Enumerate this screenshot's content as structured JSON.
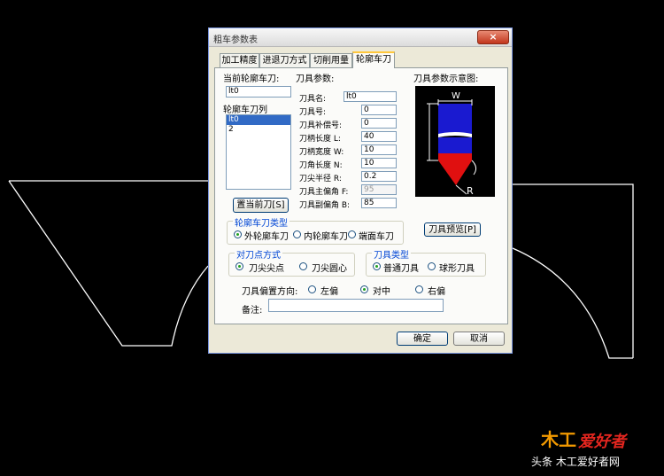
{
  "window": {
    "title": "粗车参数表",
    "close_glyph": "×"
  },
  "tabs": [
    {
      "label": "加工精度"
    },
    {
      "label": "进退刀方式"
    },
    {
      "label": "切削用量"
    },
    {
      "label": "轮廓车刀"
    }
  ],
  "current_tool": {
    "label": "当前轮廓车刀:",
    "value": "lt0"
  },
  "tool_list": {
    "label": "轮廓车刀列",
    "items": [
      "lt0",
      "2"
    ],
    "selected": 0
  },
  "set_current_button": "置当前刀[S]",
  "tool_params": {
    "section_label": "刀具参数:",
    "fields": [
      {
        "label": "刀具名:",
        "value": "lt0"
      },
      {
        "label": "刀具号:",
        "value": "0"
      },
      {
        "label": "刀具补偿号:",
        "value": "0"
      },
      {
        "label": "刀柄长度 L:",
        "value": "40"
      },
      {
        "label": "刀柄宽度 W:",
        "value": "10"
      },
      {
        "label": "刀角长度 N:",
        "value": "10"
      },
      {
        "label": "刀尖半径 R:",
        "value": "0.2"
      },
      {
        "label": "刀具主偏角 F:",
        "value": "95",
        "disabled": true
      },
      {
        "label": "刀具副偏角 B:",
        "value": "85"
      }
    ]
  },
  "diagram": {
    "label": "刀具参数示意图:",
    "w_label": "W",
    "r_label": "R"
  },
  "preview_button": "刀具预览[P]",
  "tool_type_group": {
    "title": "轮廓车刀类型",
    "options": [
      "外轮廓车刀",
      "内轮廓车刀",
      "端面车刀"
    ],
    "selected": 0
  },
  "point_group": {
    "title": "对刀点方式",
    "options": [
      "刀尖尖点",
      "刀尖圆心"
    ],
    "selected": 0
  },
  "cutter_group": {
    "title": "刀具类型",
    "options": [
      "普通刀具",
      "球形刀具"
    ],
    "selected": 0
  },
  "offset": {
    "label": "刀具偏置方向:",
    "options": [
      "左偏",
      "对中",
      "右偏"
    ],
    "selected": 1
  },
  "remark": {
    "label": "备注:",
    "value": ""
  },
  "ok_button": "确定",
  "cancel_button": "取消",
  "watermark": {
    "brand_a": "木工",
    "brand_b": "爱好者",
    "caption": "头条 木工爱好者网"
  }
}
